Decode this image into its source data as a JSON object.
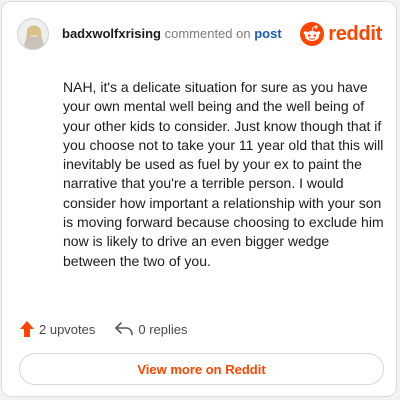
{
  "header": {
    "username": "badxwolfxrising",
    "action_text": "commented on",
    "post_link": "post",
    "brand_name": "reddit"
  },
  "comment": {
    "text": "NAH, it's a delicate situation for sure as you have your own mental well being and the well being of your other kids to consider. Just know though that if you choose not to take your 11 year old that this will inevitably be used as fuel by your ex to paint the narrative that you're a terrible person. I would consider how important a relationship with your son is moving forward because choosing to exclude him now is likely to drive an even bigger wedge between the two of you."
  },
  "footer": {
    "upvotes_label": "2 upvotes",
    "replies_label": "0 replies"
  },
  "cta": {
    "label": "View more on Reddit"
  },
  "colors": {
    "brand": "#ff4500",
    "link": "#1a5fb4",
    "text": "#1c1c1c"
  },
  "icons": {
    "upvote": "upvote-arrow-icon",
    "reply": "reply-arrow-icon",
    "brand": "reddit-snoo-icon",
    "avatar": "user-avatar"
  }
}
